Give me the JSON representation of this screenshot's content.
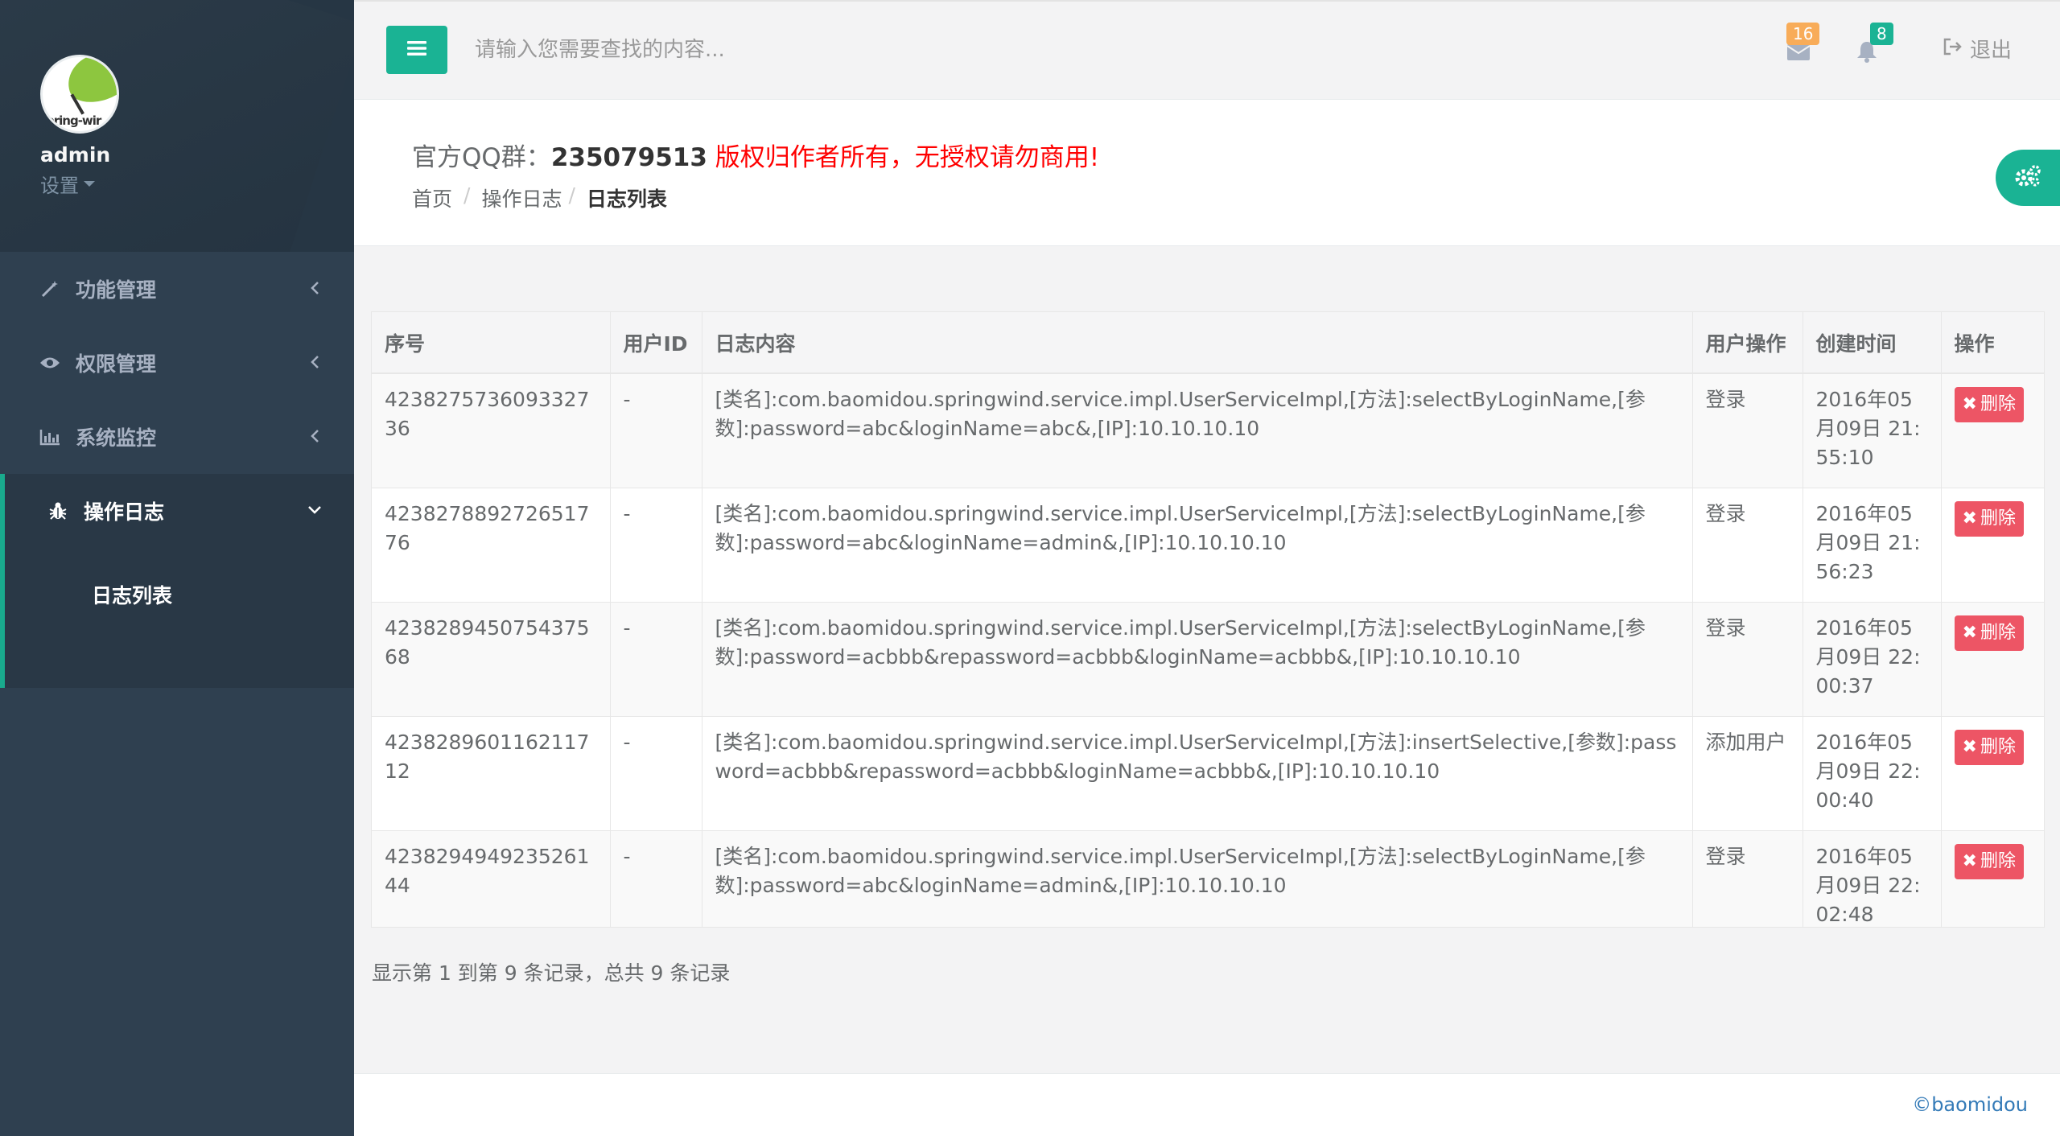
{
  "sidebar": {
    "username": "admin",
    "settings_label": "设置",
    "nav": [
      {
        "label": "功能管理",
        "icon": "magic-wand-icon"
      },
      {
        "label": "权限管理",
        "icon": "eye-icon"
      },
      {
        "label": "系统监控",
        "icon": "bar-chart-icon"
      },
      {
        "label": "操作日志",
        "icon": "bug-icon"
      }
    ],
    "sub_item": "日志列表"
  },
  "topbar": {
    "search_placeholder": "请输入您需要查找的内容...",
    "messages_count": "16",
    "notifications_count": "8",
    "logout_label": "退出"
  },
  "heading": {
    "prefix": "官方QQ群：",
    "qq": "235079513",
    "notice": " 版权归作者所有，无授权请勿商用!",
    "breadcrumb": [
      "首页",
      "操作日志",
      "日志列表"
    ]
  },
  "table": {
    "headers": [
      "序号",
      "用户ID",
      "日志内容",
      "用户操作",
      "创建时间",
      "操作"
    ],
    "delete_label": "删除",
    "rows": [
      {
        "id": "423827573609332736",
        "uid": "-",
        "content": "[类名]:com.baomidou.springwind.service.impl.UserServiceImpl,[方法]:selectByLoginName,[参数]:password=abc&loginName=abc&,[IP]:10.10.10.10",
        "op": "登录",
        "time": "2016年05月09日 21:55:10"
      },
      {
        "id": "423827889272651776",
        "uid": "-",
        "content": "[类名]:com.baomidou.springwind.service.impl.UserServiceImpl,[方法]:selectByLoginName,[参数]:password=abc&loginName=admin&,[IP]:10.10.10.10",
        "op": "登录",
        "time": "2016年05月09日 21:56:23"
      },
      {
        "id": "423828945075437568",
        "uid": "-",
        "content": "[类名]:com.baomidou.springwind.service.impl.UserServiceImpl,[方法]:selectByLoginName,[参数]:password=acbbb&repassword=acbbb&loginName=acbbb&,[IP]:10.10.10.10",
        "op": "登录",
        "time": "2016年05月09日 22:00:37"
      },
      {
        "id": "423828960116211712",
        "uid": "-",
        "content": "[类名]:com.baomidou.springwind.service.impl.UserServiceImpl,[方法]:insertSelective,[参数]:password=acbbb&repassword=acbbb&loginName=acbbb&,[IP]:10.10.10.10",
        "op": "添加用户",
        "time": "2016年05月09日 22:00:40"
      },
      {
        "id": "423829494923526144",
        "uid": "-",
        "content": "[类名]:com.baomidou.springwind.service.impl.UserServiceImpl,[方法]:selectByLoginName,[参数]:password=abc&loginName=admin&,[IP]:10.10.10.10",
        "op": "登录",
        "time": "2016年05月09日 22:02:48"
      }
    ]
  },
  "pagination_info": "显示第 1 到第 9 条记录，总共 9 条记录",
  "footer": {
    "copyright": "©baomidou"
  },
  "colors": {
    "primary": "#1ab394",
    "sidebar": "#2f4050",
    "danger": "#ed5565",
    "warning": "#f8ac59",
    "notice_red": "#ff0000",
    "link": "#337ab7"
  }
}
